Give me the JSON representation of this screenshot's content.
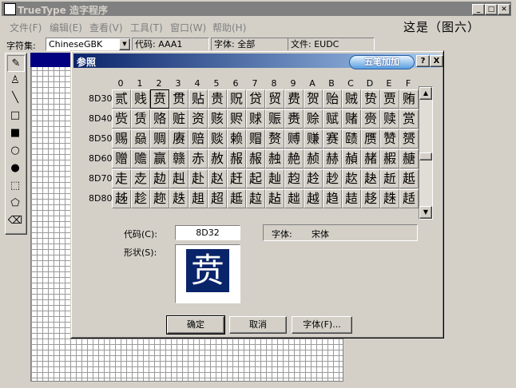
{
  "window": {
    "title": "TrueType 造字程序",
    "overlay_text": "这是（图六）"
  },
  "menu": [
    "文件(F)",
    "编辑(E)",
    "查看(V)",
    "工具(T)",
    "窗口(W)",
    "帮助(H)"
  ],
  "info": {
    "charset_label": "字符集:",
    "charset_value": "ChineseGBK",
    "code": "代码: AAA1",
    "font": "字体: 全部",
    "file": "文件: EUDC"
  },
  "tools": [
    "pencil-icon",
    "brush-icon",
    "line-icon",
    "hollow-rect-icon",
    "filled-rect-icon",
    "hollow-ellipse-icon",
    "filled-ellipse-icon",
    "rect-select-icon",
    "freeform-select-icon",
    "eraser-icon"
  ],
  "dialog": {
    "title": "参照",
    "ime_label": "五笔加加",
    "help_btn": "?",
    "close_btn": "X",
    "columns": [
      "0",
      "1",
      "2",
      "3",
      "4",
      "5",
      "6",
      "7",
      "8",
      "9",
      "A",
      "B",
      "C",
      "D",
      "E",
      "F"
    ],
    "rows": [
      {
        "code": "8D30",
        "chars": [
          "贰",
          "贱",
          "贲",
          "贯",
          "贴",
          "贵",
          "贶",
          "贷",
          "贸",
          "费",
          "贺",
          "贻",
          "贼",
          "贽",
          "贾",
          "贿"
        ]
      },
      {
        "code": "8D40",
        "chars": [
          "赀",
          "赁",
          "赂",
          "赃",
          "资",
          "赅",
          "赆",
          "赇",
          "赈",
          "赉",
          "赊",
          "赋",
          "赌",
          "赍",
          "赎",
          "赏"
        ]
      },
      {
        "code": "8D50",
        "chars": [
          "赐",
          "赑",
          "赒",
          "赓",
          "赔",
          "赕",
          "赖",
          "赗",
          "赘",
          "赙",
          "赚",
          "赛",
          "赜",
          "赝",
          "赞",
          "赟"
        ]
      },
      {
        "code": "8D60",
        "chars": [
          "赠",
          "赡",
          "赢",
          "赣",
          "赤",
          "赦",
          "赧",
          "赧",
          "赨",
          "赩",
          "赪",
          "赫",
          "赬",
          "赭",
          "赮",
          "赯"
        ]
      },
      {
        "code": "8D70",
        "chars": [
          "走",
          "赱",
          "赲",
          "赳",
          "赴",
          "赵",
          "赶",
          "起",
          "赸",
          "赹",
          "赺",
          "赻",
          "赼",
          "赽",
          "赾",
          "赿"
        ]
      },
      {
        "code": "8D80",
        "chars": [
          "趀",
          "趁",
          "趂",
          "趃",
          "趄",
          "超",
          "趆",
          "趇",
          "趈",
          "趉",
          "越",
          "趋",
          "趌",
          "趍",
          "趎",
          "趏"
        ]
      }
    ],
    "selected": {
      "row": 0,
      "col": 2
    },
    "code_label": "代码(C):",
    "code_value": "8D32",
    "font_label": "字体:",
    "font_value": "宋体",
    "shape_label": "形状(S):",
    "preview_char": "贲",
    "ok": "确定",
    "cancel": "取消",
    "font_btn": "字体(F)..."
  },
  "colors": {
    "dialog_title": "#0a246a",
    "grid_header": "#000080"
  }
}
